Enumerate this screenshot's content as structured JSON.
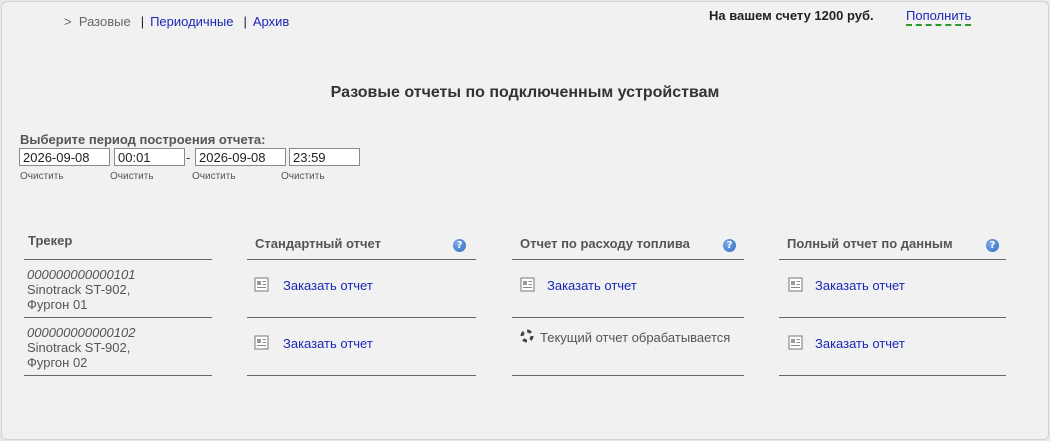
{
  "nav": {
    "current": "Разовые",
    "current_prefix": ">",
    "separator": "|",
    "links": [
      "Периодичные",
      "Архив"
    ]
  },
  "account": {
    "balance_text": "На вашем счету 1200 руб.",
    "topup_label": "Пополнить"
  },
  "page_title": "Разовые отчеты по подключенным устройствам",
  "period": {
    "label": "Выберите период построения отчета:",
    "from_date": "2026-09-08",
    "from_time": "00:01",
    "separator": "-",
    "to_date": "2026-09-08",
    "to_time": "23:59",
    "clear_label": "Очистить"
  },
  "table": {
    "headers": {
      "tracker": "Трекер",
      "standard": "Стандартный отчет",
      "fuel": "Отчет по расходу топлива",
      "full": "Полный отчет по данным"
    },
    "help_glyph": "?",
    "rows": [
      {
        "tracker_id": "000000000000101",
        "tracker_model": "Sinotrack ST-902,",
        "tracker_name": "Фургон 01",
        "standard": "Заказать отчет",
        "fuel": "Заказать отчет",
        "full": "Заказать отчет"
      },
      {
        "tracker_id": "000000000000102",
        "tracker_model": "Sinotrack ST-902,",
        "tracker_name": "Фургон 02",
        "standard": "Заказать отчет",
        "fuel_status": "Текущий отчет обрабатывается",
        "full": "Заказать отчет"
      }
    ]
  },
  "colors": {
    "link": "#1a28b8",
    "topup_underline": "#2a9a2a",
    "help_icon": "#2f6cc4",
    "panel_bg": "#f1f1f1"
  },
  "icons": {
    "order": "document-icon",
    "help": "help-icon",
    "processing": "spinner-icon"
  }
}
